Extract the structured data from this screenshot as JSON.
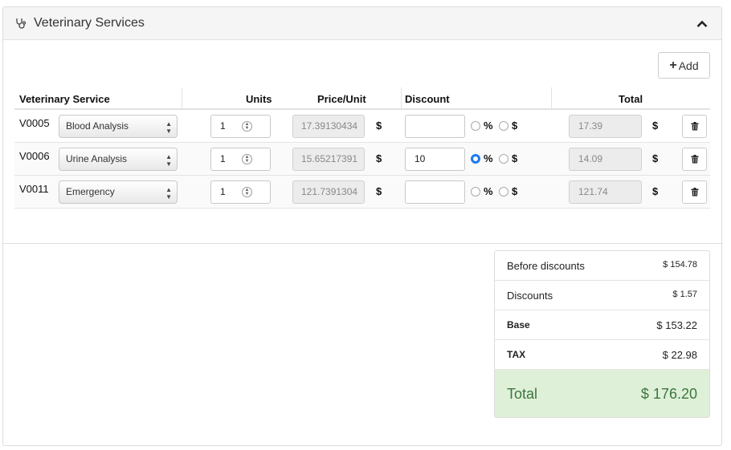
{
  "panel": {
    "title": "Veterinary Services",
    "add_label": "Add",
    "icons": {
      "header": "stethoscope-icon",
      "collapse": "chevron-up-icon",
      "add": "plus-icon",
      "delete": "trash-icon",
      "spinner": "spinner-arrows-icon"
    }
  },
  "table": {
    "headers": {
      "service": "Veterinary Service",
      "units": "Units",
      "price": "Price/Unit",
      "discount": "Discount",
      "total": "Total"
    },
    "currency_symbol": "$",
    "percent_symbol": "%",
    "rows": [
      {
        "code": "V0005",
        "service": "Blood Analysis",
        "units": "1",
        "price": "17.39130434",
        "discount": "",
        "discount_type": "none",
        "total": "17.39"
      },
      {
        "code": "V0006",
        "service": "Urine Analysis",
        "units": "1",
        "price": "15.65217391",
        "discount": "10",
        "discount_type": "percent",
        "total": "14.09"
      },
      {
        "code": "V0011",
        "service": "Emergency",
        "units": "1",
        "price": "121.7391304",
        "discount": "",
        "discount_type": "none",
        "total": "121.74"
      }
    ]
  },
  "summary": {
    "before_discounts": {
      "label": "Before discounts",
      "value": "$ 154.78"
    },
    "discounts": {
      "label": "Discounts",
      "value": "$ 1.57"
    },
    "base": {
      "label": "Base",
      "value": "$ 153.22"
    },
    "tax": {
      "label": "TAX",
      "value": "$ 22.98"
    },
    "total": {
      "label": "Total",
      "value": "$ 176.20"
    }
  },
  "colors": {
    "radio_selected": "#1e7bf0",
    "total_bg": "#dff0d8",
    "total_text": "#3c763d"
  }
}
